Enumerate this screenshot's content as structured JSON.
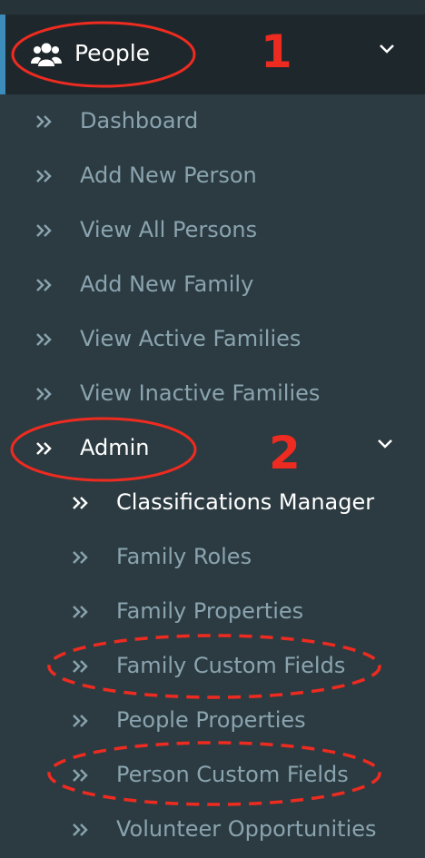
{
  "menu": {
    "header": {
      "label": "People",
      "icon": "users-icon"
    },
    "items": [
      {
        "label": "Dashboard"
      },
      {
        "label": "Add New Person"
      },
      {
        "label": "View All Persons"
      },
      {
        "label": "Add New Family"
      },
      {
        "label": "View Active Families"
      },
      {
        "label": "View Inactive Families"
      }
    ],
    "admin": {
      "label": "Admin",
      "subitems": [
        {
          "label": "Classifications Manager"
        },
        {
          "label": "Family Roles"
        },
        {
          "label": "Family Properties"
        },
        {
          "label": "Family Custom Fields"
        },
        {
          "label": "People Properties"
        },
        {
          "label": "Person Custom Fields"
        },
        {
          "label": "Volunteer Opportunities"
        }
      ]
    }
  },
  "annotations": {
    "step1": "1",
    "step2": "2"
  },
  "colors": {
    "sidebar_bg": "#2c3b41",
    "header_bg": "#1e282c",
    "accent": "#3c8dbc",
    "item_text": "#8aa4af",
    "active_text": "#ffffff",
    "annotation": "#ee2b20"
  }
}
